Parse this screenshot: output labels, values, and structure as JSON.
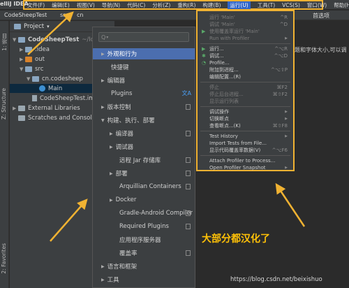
{
  "menubar": {
    "app": "elliJ IDEA",
    "items": [
      "文件(F)",
      "编辑(E)",
      "视图(V)",
      "导航(N)",
      "代码(C)",
      "分析(Z)",
      "重构(R)",
      "构建(B)",
      "运行(U)",
      "工具(T)",
      "VCS(S)",
      "窗口(W)",
      "帮助(H)"
    ]
  },
  "breadcrumb": {
    "project": "CodeSheepTest",
    "src": "src",
    "cn": "cn",
    "right_hint": "首选项"
  },
  "toolstrip": {
    "project_tab": "1: 项目",
    "structure_tab": "Z: Structure",
    "favorites_tab": "2: Favorites"
  },
  "project_panel": {
    "header": "Project",
    "tree": [
      {
        "label": "CodeSheepTest",
        "suffix": "~/Ide"
      },
      {
        "label": ".idea"
      },
      {
        "label": "out"
      },
      {
        "label": "src"
      },
      {
        "label": "cn.codesheep"
      },
      {
        "label": "Main"
      },
      {
        "label": "CodeSheepTest.im"
      },
      {
        "label": "External Libraries"
      },
      {
        "label": "Scratches and Console"
      }
    ]
  },
  "editor": {
    "hint": "题和字体大小,可以调"
  },
  "settings": {
    "search_placeholder": "Q",
    "items": [
      {
        "label": "外观和行为",
        "arrow": "▶",
        "selected": true
      },
      {
        "label": "快捷键"
      },
      {
        "label": "编辑器",
        "arrow": "▶"
      },
      {
        "label": "Plugins",
        "lang_icon": "文A"
      },
      {
        "label": "版本控制",
        "arrow": "▶",
        "copy": true
      },
      {
        "label": "构建、执行、部署",
        "arrow": "▼"
      },
      {
        "label": "编译器",
        "arrow": "▶",
        "copy": true,
        "indent": 1
      },
      {
        "label": "调试器",
        "arrow": "▶",
        "indent": 1
      },
      {
        "label": "远程 Jar 存储库",
        "copy": true,
        "indent": 1
      },
      {
        "label": "部署",
        "arrow": "▶",
        "copy": true,
        "indent": 1
      },
      {
        "label": "Arquillian Containers",
        "copy": true,
        "indent": 1
      },
      {
        "label": "Docker",
        "arrow": "▶",
        "indent": 1
      },
      {
        "label": "Gradle-Android Compiler",
        "copy": true,
        "indent": 1
      },
      {
        "label": "Required Plugins",
        "copy": true,
        "indent": 1
      },
      {
        "label": "应用程序服务器",
        "indent": 1
      },
      {
        "label": "覆盖率",
        "copy": true,
        "indent": 1
      },
      {
        "label": "语言和框架",
        "arrow": "▶"
      },
      {
        "label": "工具",
        "arrow": "▶"
      }
    ]
  },
  "run_menu": {
    "items": [
      {
        "label": "运行 'Main'",
        "shortcut": "^R",
        "dim": true
      },
      {
        "label": "调试 'Main'",
        "shortcut": "^D",
        "dim": true
      },
      {
        "label": "使用覆盖率运行 'Main'",
        "dim": true,
        "icon": "▶"
      },
      {
        "label": "Run with Profiler",
        "dim": true,
        "submenu": true
      },
      {
        "sep": true
      },
      {
        "label": "运行...",
        "shortcut": "^⌥R",
        "icon": "▶"
      },
      {
        "label": "调试...",
        "shortcut": "^⌥D",
        "icon": "✱"
      },
      {
        "label": "Profile...",
        "icon": "◔"
      },
      {
        "label": "附加到进程...",
        "shortcut": "^⌥⇧P"
      },
      {
        "label": "编辑配置...(R)"
      },
      {
        "sep": true
      },
      {
        "label": "停止",
        "shortcut": "⌘F2",
        "dim": true
      },
      {
        "label": "停止后台进程...",
        "shortcut": "⌘⇧F2",
        "dim": true
      },
      {
        "label": "显示运行列表",
        "dim": true
      },
      {
        "sep": true
      },
      {
        "label": "调试操作",
        "submenu": true
      },
      {
        "label": "切换断点",
        "submenu": true
      },
      {
        "label": "查看断点...(K)",
        "shortcut": "⌘⇧F8"
      },
      {
        "sep": true
      },
      {
        "label": "Test History",
        "submenu": true
      },
      {
        "label": "Import Tests from File..."
      },
      {
        "label": "显示代码覆盖率数据(V)",
        "shortcut": "^⌥F6"
      },
      {
        "sep": true
      },
      {
        "label": "Attach Profiler to Process..."
      },
      {
        "label": "Open Profiler Snapshot",
        "submenu": true
      }
    ]
  },
  "annotation": "大部分都汉化了",
  "watermark": "https://blog.csdn.net/beixishuo",
  "colors": {
    "highlight_border": "#f0b232",
    "arrow": "#f0b232",
    "selection": "#4b6eaf",
    "menu_active": "#2f65ca"
  }
}
